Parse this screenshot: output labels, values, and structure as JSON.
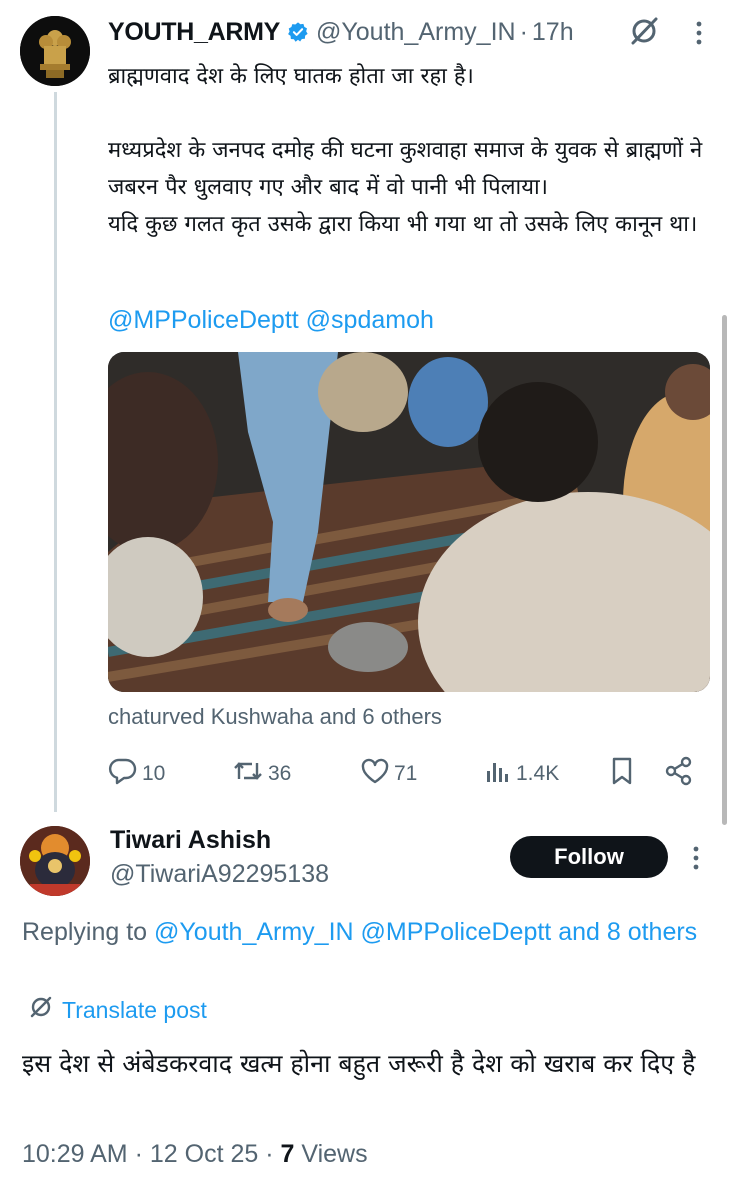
{
  "post": {
    "author_name": "YOUTH_ARMY",
    "handle": "@Youth_Army_IN",
    "separator": "·",
    "time": "17h",
    "paragraphs": [
      "ब्राह्मणवाद देश के लिए घातक होता जा रहा है।",
      "",
      "मध्यप्रदेश के जनपद दमोह की घटना कुशवाहा समाज के युवक से ब्राह्मणों ने जबरन पैर धुलवाए गए और बाद में वो पानी भी पिलाया।",
      "यदि कुछ गलत कृत उसके द्वारा किया भी गया था तो उसके लिए कानून था।"
    ],
    "mentions": "@MPPoliceDeptt @spdamoh",
    "liked_by": "chaturved Kushwaha and 6 others",
    "actions": {
      "replies": "10",
      "reposts": "36",
      "likes": "71",
      "views": "1.4K"
    }
  },
  "reply": {
    "author_name": "Tiwari Ashish",
    "handle": "@TiwariA92295138",
    "follow_label": "Follow",
    "replying_prefix": "Replying to ",
    "replying_links": "@Youth_Army_IN @MPPoliceDeptt and 8 others",
    "translate_label": "Translate post",
    "text": "इस देश से अंबेडकरवाद खत्म होना बहुत जरूरी है देश को खराब कर दिए है",
    "time": "10:29 AM",
    "date": "12 Oct 25",
    "views_count": "7",
    "views_label": "Views"
  },
  "colors": {
    "link": "#1d9bf0",
    "secondary_text": "#536471",
    "primary_text": "#0f1419",
    "verified": "#1d9bf0"
  },
  "icons": [
    "verified-badge-icon",
    "grok-icon",
    "more-icon",
    "reply-icon",
    "repost-icon",
    "like-icon",
    "views-icon",
    "bookmark-icon",
    "share-icon",
    "translate-icon"
  ]
}
